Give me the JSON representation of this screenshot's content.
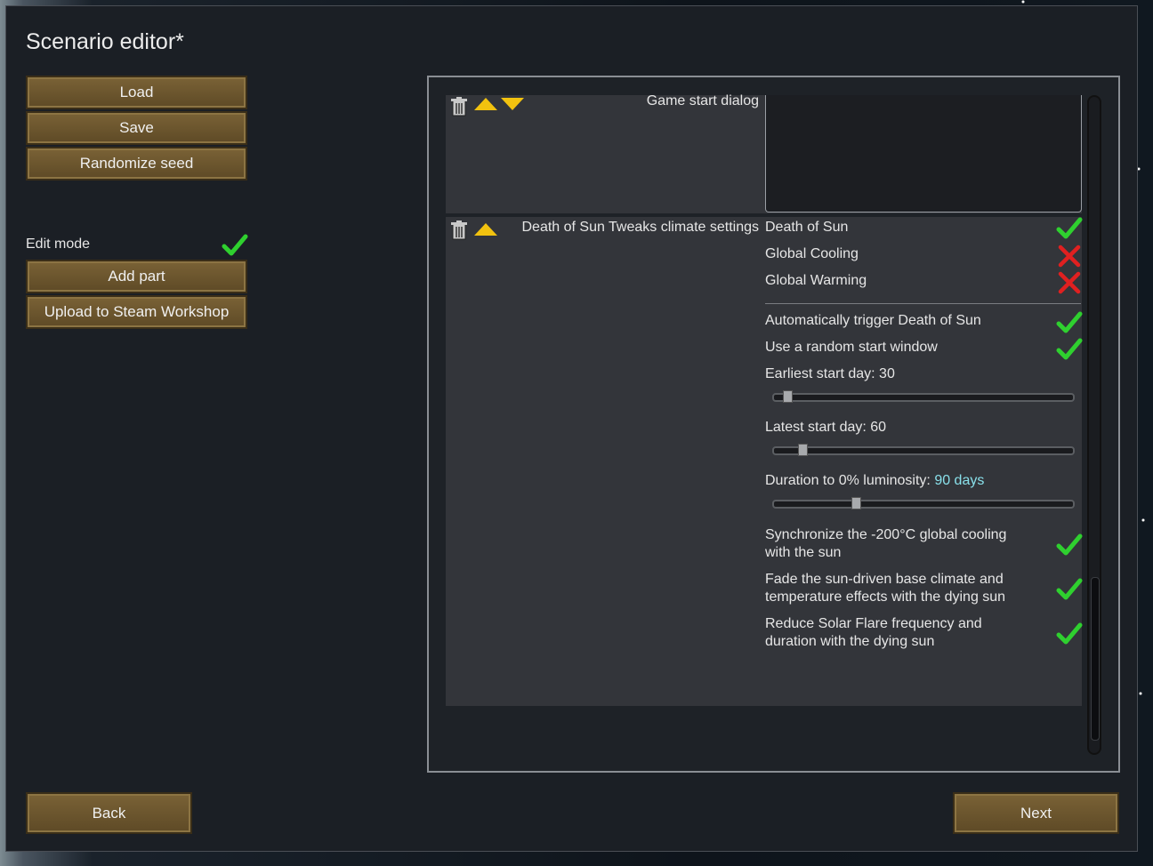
{
  "window": {
    "title": "Scenario editor*"
  },
  "left_buttons": {
    "load": "Load",
    "save": "Save",
    "randomize_seed": "Randomize seed",
    "add_part": "Add part",
    "upload": "Upload to Steam Workshop"
  },
  "edit_mode": {
    "label": "Edit mode",
    "checked": true
  },
  "footer": {
    "back": "Back",
    "next": "Next"
  },
  "parts": {
    "game_start": {
      "label": "Game start dialog",
      "text": ""
    },
    "death_of_sun": {
      "label": "Death of Sun Tweaks climate settings",
      "climate_options": [
        {
          "label": "Death of Sun",
          "state": "check"
        },
        {
          "label": "Global Cooling",
          "state": "cross"
        },
        {
          "label": "Global Warming",
          "state": "cross"
        }
      ],
      "auto_trigger": {
        "label": "Automatically trigger Death of Sun",
        "state": "check"
      },
      "random_window": {
        "label": "Use a random start window",
        "state": "check"
      },
      "earliest": {
        "label": "Earliest start day: 30",
        "value": 30
      },
      "latest": {
        "label": "Latest start day: 60",
        "value": 60
      },
      "duration": {
        "label": "Duration to 0% luminosity: ",
        "value_text": "90 days",
        "value": 90
      },
      "sync_cooling": {
        "line1": "Synchronize the -200°C global cooling",
        "line2": "with the sun",
        "state": "check"
      },
      "fade_climate": {
        "line1": "Fade the sun-driven base climate and",
        "line2": "temperature effects with the dying sun",
        "state": "check"
      },
      "solar_flare": {
        "line1": "Reduce Solar Flare frequency and",
        "line2": "duration with the dying sun",
        "state": "check"
      }
    }
  },
  "colors": {
    "accent_check": "#2fd02f",
    "accent_cross": "#e02020",
    "button": "#6b5530",
    "value_cyan": "#89e0ea"
  },
  "icons": {
    "delete": "trash-icon",
    "up": "arrow-up-icon",
    "down": "arrow-down-icon"
  }
}
